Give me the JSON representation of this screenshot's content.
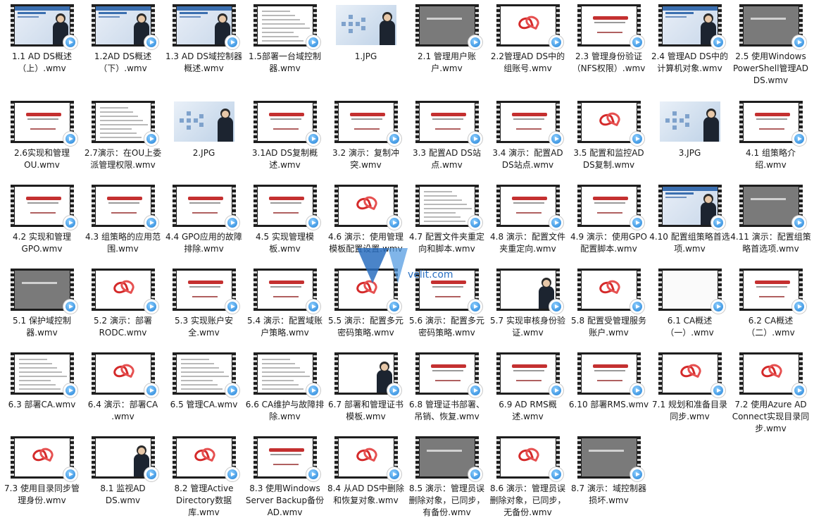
{
  "files": [
    {
      "label": "1.1 AD DS概述（上）.wmv",
      "kind": "slide"
    },
    {
      "label": "1.2AD DS概述（下）.wmv",
      "kind": "slide"
    },
    {
      "label": "1.3 AD DS域控制器概述.wmv",
      "kind": "slide"
    },
    {
      "label": "1.5部署一台域控制器.wmv",
      "kind": "text"
    },
    {
      "label": "1.JPG",
      "kind": "jpg"
    },
    {
      "label": "2.1 管理用户账户.wmv",
      "kind": "gray"
    },
    {
      "label": "2.2管理AD DS中的组账号.wmv",
      "kind": "logo"
    },
    {
      "label": "2.3 管理身份验证（NFS权限）.wmv",
      "kind": "brand"
    },
    {
      "label": "2.4 管理AD DS中的计算机对象.wmv",
      "kind": "slide"
    },
    {
      "label": "2.5 使用Windows PowerShell管理AD DS.wmv",
      "kind": "gray"
    },
    {
      "label": "2.6实现和管理OU.wmv",
      "kind": "brand"
    },
    {
      "label": "2.7演示：在OU上委派管理权限.wmv",
      "kind": "text"
    },
    {
      "label": "2.JPG",
      "kind": "jpg"
    },
    {
      "label": "3.1AD DS复制概述.wmv",
      "kind": "brand"
    },
    {
      "label": "3.2 演示：复制冲突.wmv",
      "kind": "brand"
    },
    {
      "label": "3.3 配置AD DS站点.wmv",
      "kind": "brand"
    },
    {
      "label": "3.4 演示：配置AD DS站点.wmv",
      "kind": "brand"
    },
    {
      "label": "3.5 配置和监控AD DS复制.wmv",
      "kind": "logo"
    },
    {
      "label": "3.JPG",
      "kind": "jpg"
    },
    {
      "label": "4.1 组策略介绍.wmv",
      "kind": "brand"
    },
    {
      "label": "4.2 实现和管理GPO.wmv",
      "kind": "brand"
    },
    {
      "label": "4.3 组策略的应用范围.wmv",
      "kind": "brand"
    },
    {
      "label": "4.4 GPO应用的故障排除.wmv",
      "kind": "brand"
    },
    {
      "label": "4.5 实现管理模板.wmv",
      "kind": "brand"
    },
    {
      "label": "4.6 演示：使用管理模板配置设置.wmv",
      "kind": "logo"
    },
    {
      "label": "4.7 配置文件夹重定向和脚本.wmv",
      "kind": "text"
    },
    {
      "label": "4.8 演示：配置文件夹重定向.wmv",
      "kind": "brand"
    },
    {
      "label": "4.9 演示：使用GPO配置脚本.wmv",
      "kind": "brand"
    },
    {
      "label": "4.10 配置组策略首选项.wmv",
      "kind": "slide"
    },
    {
      "label": "4.11 演示：配置组策略首选项.wmv",
      "kind": "gray"
    },
    {
      "label": "5.1 保护域控制器.wmv",
      "kind": "gray"
    },
    {
      "label": "5.2 演示：部署RODC.wmv",
      "kind": "logo"
    },
    {
      "label": "5.3 实现账户安全.wmv",
      "kind": "brand"
    },
    {
      "label": "5.4 演示：配置域账户策略.wmv",
      "kind": "brand"
    },
    {
      "label": "5.5 演示：配置多元密码策略.wmv",
      "kind": "logo"
    },
    {
      "label": "5.6 演示：配置多元密码策略.wmv",
      "kind": "brand"
    },
    {
      "label": "5.7 实现审核身份验证.wmv",
      "kind": "presenter"
    },
    {
      "label": "5.8 配置受管理服务账户.wmv",
      "kind": "logo"
    },
    {
      "label": "6.1 CA概述（一）.wmv",
      "kind": "blank"
    },
    {
      "label": "6.2 CA概述（二）.wmv",
      "kind": "brand"
    },
    {
      "label": "6.3 部署CA.wmv",
      "kind": "text"
    },
    {
      "label": "6.4 演示：部署CA .wmv",
      "kind": "logo"
    },
    {
      "label": "6.5 管理CA.wmv",
      "kind": "text"
    },
    {
      "label": "6.6 CA维护与故障排除.wmv",
      "kind": "text"
    },
    {
      "label": "6.7 部署和管理证书模板.wmv",
      "kind": "presenter"
    },
    {
      "label": "6.8 管理证书部署、吊销、恢复.wmv",
      "kind": "brand"
    },
    {
      "label": "6.9 AD RMS概述.wmv",
      "kind": "brand"
    },
    {
      "label": "6.10 部署RMS.wmv",
      "kind": "brand"
    },
    {
      "label": "7.1 规划和准备目录同步.wmv",
      "kind": "logo"
    },
    {
      "label": "7.2 使用Azure AD Connect实现目录同步.wmv",
      "kind": "logo"
    },
    {
      "label": "7.3 使用目录同步管理身份.wmv",
      "kind": "logo"
    },
    {
      "label": "8.1 监视AD DS.wmv",
      "kind": "presenter"
    },
    {
      "label": "8.2 管理Active Directory数据库.wmv",
      "kind": "logo"
    },
    {
      "label": "8.3 使用Windows Server Backup备份AD.wmv",
      "kind": "brand"
    },
    {
      "label": "8.4 从AD DS中删除和恢复对象.wmv",
      "kind": "logo"
    },
    {
      "label": "8.5 演示：管理员误删除对象，已同步，有备份.wmv",
      "kind": "gray"
    },
    {
      "label": "8.6 演示：管理员误删除对象，已同步，无备份.wmv",
      "kind": "logo"
    },
    {
      "label": "8.7 演示：域控制器损坏.wmv",
      "kind": "gray"
    }
  ],
  "watermark": {
    "text": "velit.com"
  },
  "colors": {
    "label": "#1a1a1a",
    "play_icon": "#1e7fd6",
    "film": "#1e1e1e",
    "logo_red": "#d42a2a"
  }
}
